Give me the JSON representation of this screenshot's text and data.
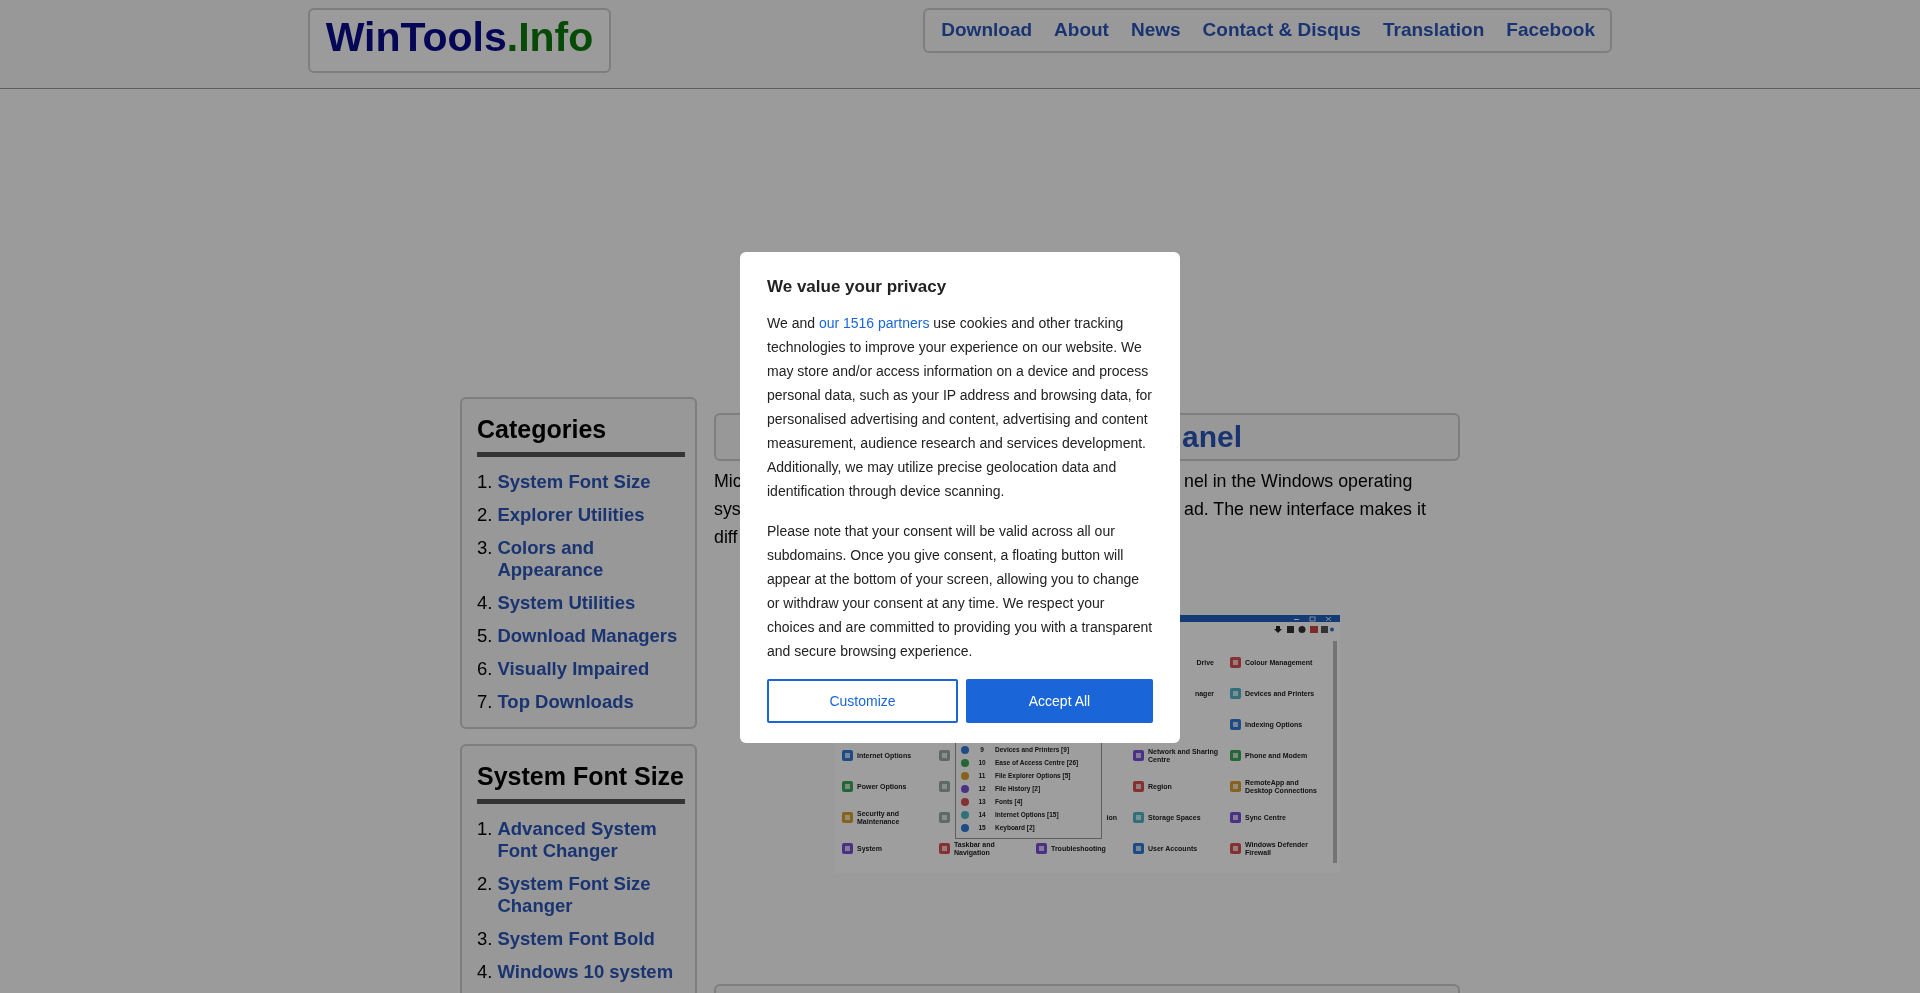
{
  "header": {
    "logo": {
      "name": "WinTools",
      "suffix": ".Info"
    },
    "nav": [
      "Download",
      "About",
      "News",
      "Contact & Disqus",
      "Translation",
      "Facebook"
    ]
  },
  "sidebar": [
    {
      "title": "Categories",
      "items": [
        {
          "number": "1.",
          "label": "System Font Size"
        },
        {
          "number": "2.",
          "label": "Explorer Utilities"
        },
        {
          "number": "3.",
          "label": "Colors and Appearance"
        },
        {
          "number": "4.",
          "label": "System Utilities"
        },
        {
          "number": "5.",
          "label": "Download Managers"
        },
        {
          "number": "6.",
          "label": "Visually Impaired"
        },
        {
          "number": "7.",
          "label": "Top Downloads"
        }
      ]
    },
    {
      "title": "System Font Size",
      "items": [
        {
          "number": "1.",
          "label": "Advanced System Font Changer"
        },
        {
          "number": "2.",
          "label": "System Font Size Changer"
        },
        {
          "number": "3.",
          "label": "System Font Bold"
        },
        {
          "number": "4.",
          "label": "Windows 10 system"
        }
      ]
    }
  ],
  "article": {
    "title": "anel",
    "intro_left": [
      "Mic",
      "sys",
      "diff"
    ],
    "intro_right": [
      "nel in the Windows operating",
      "ad. The new interface makes it"
    ],
    "screenshot": {
      "columns": [
        {
          "lower": [
            {
              "kind": "item",
              "label": "Internet Options"
            },
            {
              "kind": "item",
              "label": "Power Options"
            },
            {
              "kind": "item",
              "label": "Security and Maintenance"
            },
            {
              "kind": "item",
              "label": "System"
            }
          ]
        },
        {
          "lower": [
            {
              "kind": "icon"
            },
            {
              "kind": "icon"
            },
            {
              "kind": "icon"
            },
            {
              "kind": "item",
              "label": "Taskbar and Navigation"
            }
          ]
        },
        {
          "lower": [
            {
              "kind": "fragment",
              "label": "ion"
            },
            {
              "kind": "item",
              "label": "Troubleshooting"
            }
          ]
        },
        {
          "upper": [
            {
              "kind": "fragment",
              "label": "Drive"
            },
            {
              "kind": "fragment",
              "label": "nager"
            }
          ],
          "lower": [
            {
              "kind": "item",
              "label": "Network and Sharing Centre"
            },
            {
              "kind": "item",
              "label": "Region"
            },
            {
              "kind": "item",
              "label": "Storage Spaces"
            },
            {
              "kind": "item",
              "label": "User Accounts"
            }
          ]
        },
        {
          "lower": [
            {
              "kind": "item",
              "label": "Colour Management"
            },
            {
              "kind": "item",
              "label": "Devices and Printers"
            },
            {
              "kind": "item",
              "label": "Indexing Options"
            },
            {
              "kind": "item",
              "label": "Phone and Modem"
            },
            {
              "kind": "item",
              "label": "RemoteApp and Desktop Connections"
            },
            {
              "kind": "item",
              "label": "Sync Centre"
            },
            {
              "kind": "item",
              "label": "Windows Defender Firewall"
            }
          ]
        }
      ],
      "dropdown": [
        {
          "number": "9",
          "label": "Devices and Printers [9]"
        },
        {
          "number": "10",
          "label": "Ease of Access Centre [26]"
        },
        {
          "number": "11",
          "label": "File Explorer Options [5]"
        },
        {
          "number": "12",
          "label": "File History [2]"
        },
        {
          "number": "13",
          "label": "Fonts [4]"
        },
        {
          "number": "14",
          "label": "Internet Options [15]"
        },
        {
          "number": "15",
          "label": "Keyboard [2]"
        }
      ]
    }
  },
  "consent": {
    "title": "We value your privacy",
    "text_before": "We and ",
    "link": "our 1516 partners",
    "text_after": " use cookies and other tracking technologies to improve your experience on our website. We may store and/or access information on a device and process personal data, such as your IP address and browsing data, for personalised advertising and content, advertising and content measurement, audience research and services development. Additionally, we may utilize precise geolocation data and identification through device scanning.",
    "note": "Please note that your consent will be valid across all our subdomains. Once you give consent, a floating button will appear at the bottom of your screen, allowing you to change or withdraw your consent at any time. We respect your choices and are committed to providing you with a transparent and secure browsing experience.",
    "buttons": [
      {
        "kind": "outline",
        "label": "Customize"
      },
      {
        "kind": "primary",
        "label": "Accept All"
      }
    ]
  }
}
